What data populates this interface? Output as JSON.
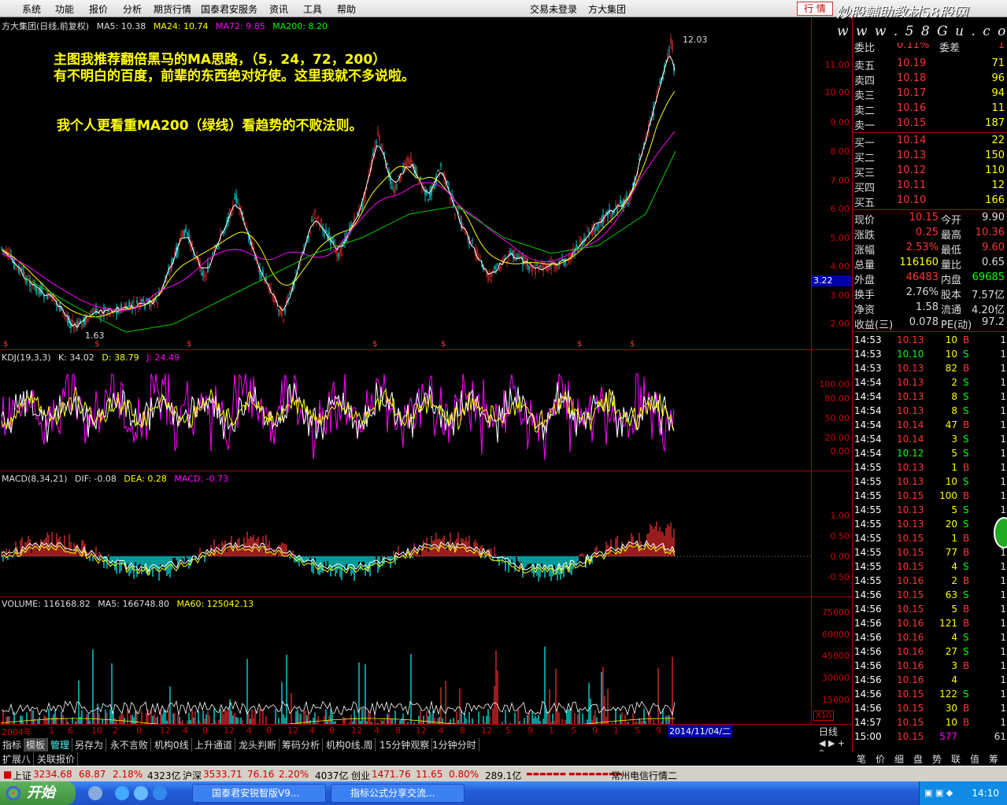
{
  "menu": {
    "items": [
      "系统",
      "功能",
      "报价",
      "分析",
      "期货行情",
      "国泰君安服务",
      "资讯",
      "工具",
      "帮助"
    ],
    "trade_status": "交易未登录",
    "stock_name": "方大集团",
    "quote_button": "行 情"
  },
  "watermark": {
    "title": "炒股輔助教材58股网",
    "url": "w w w . 5 8 G u . c o m"
  },
  "main_chart": {
    "title_name": "方大集团(日线,前复权)",
    "ma5": "MA5: 10.38",
    "ma24": "MA24: 10.74",
    "ma72": "MA72: 9.85",
    "ma200": "MA200: 8.20",
    "high_label": "12.03",
    "low_label": "1.63",
    "last_price_box": "3.22",
    "y_ticks": [
      "11.00",
      "10.00",
      "9.00",
      "8.00",
      "7.00",
      "6.00",
      "5.00",
      "4.00",
      "3.00",
      "2.00"
    ],
    "annotation_line1": "主图我推荐翻倍黑马的MA思路，（5，24，72，200）",
    "annotation_line2": "有不明白的百度，前辈的东西绝对好使。这里我就不多说啦。",
    "annotation_line3": "我个人更看重MA200（绿线）看趋势的不败法则。"
  },
  "kdj": {
    "title": "KDJ(19,3,3)",
    "k": "K: 34.02",
    "d": "D: 38.79",
    "j": "J: 24.49",
    "y_ticks": [
      "100.00",
      "80.00",
      "50.00",
      "20.00",
      "0.00"
    ]
  },
  "macd": {
    "title": "MACD(8,34,21)",
    "dif": "DIF: -0.08",
    "dea": "DEA: 0.28",
    "macd": "MACD: -0.73",
    "y_ticks": [
      "1.00",
      "0.50",
      "0.00",
      "-0.50"
    ]
  },
  "volume": {
    "title": "VOLUME: 116168.82",
    "ma5": "MA5: 166748.80",
    "ma60": "MA60: 125042.13",
    "y_ticks": [
      "75000",
      "60000",
      "45000",
      "30000",
      "15000"
    ],
    "unit": "X10"
  },
  "date_axis": {
    "labels": [
      "2004年",
      "1",
      "6",
      "10",
      "2",
      "8",
      "12",
      "4",
      "8",
      "12",
      "4",
      "8",
      "12",
      "4",
      "8",
      "12",
      "4",
      "8",
      "12",
      "4",
      "8",
      "12",
      "5",
      "9",
      "1",
      "5",
      "9",
      "1",
      "5",
      "9"
    ],
    "current_date": "2014/11/04/二",
    "period": "日线"
  },
  "tabs_row1": [
    "指标",
    "模板",
    "管理",
    "另存为",
    "永不言败",
    "机构0线",
    "上升通道",
    "龙头判断",
    "筹码分析",
    "机构0线.周",
    "15分钟观察",
    "1分钟分时"
  ],
  "tabs_row2": [
    "扩展八",
    "关联报价"
  ],
  "quote": {
    "header": {
      "label": "委比",
      "value": "0.11%",
      "label2": "委差",
      "value2": "1"
    },
    "asks": [
      {
        "label": "卖五",
        "price": "10.19",
        "vol": "71"
      },
      {
        "label": "卖四",
        "price": "10.18",
        "vol": "96"
      },
      {
        "label": "卖三",
        "price": "10.17",
        "vol": "94"
      },
      {
        "label": "卖二",
        "price": "10.16",
        "vol": "11"
      },
      {
        "label": "卖一",
        "price": "10.15",
        "vol": "187"
      }
    ],
    "bids": [
      {
        "label": "买一",
        "price": "10.14",
        "vol": "22"
      },
      {
        "label": "买二",
        "price": "10.13",
        "vol": "150"
      },
      {
        "label": "买三",
        "price": "10.12",
        "vol": "110"
      },
      {
        "label": "买四",
        "price": "10.11",
        "vol": "12"
      },
      {
        "label": "买五",
        "price": "10.10",
        "vol": "166"
      }
    ],
    "stats": [
      {
        "l1": "现价",
        "v1": "10.15",
        "l2": "今开",
        "v2": "9.90"
      },
      {
        "l1": "涨跌",
        "v1": "0.25",
        "l2": "最高",
        "v2": "10.36"
      },
      {
        "l1": "涨幅",
        "v1": "2.53%",
        "l2": "最低",
        "v2": "9.60"
      },
      {
        "l1": "总量",
        "v1": "116160",
        "l2": "量比",
        "v2": "0.65"
      },
      {
        "l1": "外盘",
        "v1": "46483",
        "l2": "内盘",
        "v2": "69685"
      },
      {
        "l1": "换手",
        "v1": "2.76%",
        "l2": "股本",
        "v2": "7.57亿"
      },
      {
        "l1": "净资",
        "v1": "1.58",
        "l2": "流通",
        "v2": "4.20亿"
      },
      {
        "l1": "收益(三)",
        "v1": "0.078",
        "l2": "PE(动)",
        "v2": "97.2"
      }
    ],
    "ticks": [
      {
        "t": "14:53",
        "p": "10.13",
        "v": "10",
        "s": "B",
        "n": "1"
      },
      {
        "t": "14:53",
        "p": "10.10",
        "v": "10",
        "s": "S",
        "n": "1"
      },
      {
        "t": "14:53",
        "p": "10.13",
        "v": "82",
        "s": "B",
        "n": "1"
      },
      {
        "t": "14:54",
        "p": "10.13",
        "v": "2",
        "s": "S",
        "n": "1"
      },
      {
        "t": "14:54",
        "p": "10.13",
        "v": "8",
        "s": "S",
        "n": "1"
      },
      {
        "t": "14:54",
        "p": "10.13",
        "v": "8",
        "s": "S",
        "n": "1"
      },
      {
        "t": "14:54",
        "p": "10.14",
        "v": "47",
        "s": "B",
        "n": "1"
      },
      {
        "t": "14:54",
        "p": "10.14",
        "v": "3",
        "s": "S",
        "n": "1"
      },
      {
        "t": "14:54",
        "p": "10.12",
        "v": "5",
        "s": "S",
        "n": "1"
      },
      {
        "t": "14:55",
        "p": "10.13",
        "v": "1",
        "s": "B",
        "n": "1"
      },
      {
        "t": "14:55",
        "p": "10.13",
        "v": "10",
        "s": "S",
        "n": "1"
      },
      {
        "t": "14:55",
        "p": "10.15",
        "v": "100",
        "s": "B",
        "n": "1"
      },
      {
        "t": "14:55",
        "p": "10.13",
        "v": "5",
        "s": "S",
        "n": "1"
      },
      {
        "t": "14:55",
        "p": "10.13",
        "v": "20",
        "s": "S",
        "n": "1"
      },
      {
        "t": "14:55",
        "p": "10.15",
        "v": "1",
        "s": "B",
        "n": "1"
      },
      {
        "t": "14:55",
        "p": "10.15",
        "v": "77",
        "s": "B",
        "n": "1"
      },
      {
        "t": "14:55",
        "p": "10.15",
        "v": "4",
        "s": "S",
        "n": "1"
      },
      {
        "t": "14:55",
        "p": "10.16",
        "v": "2",
        "s": "B",
        "n": "1"
      },
      {
        "t": "14:56",
        "p": "10.15",
        "v": "63",
        "s": "S",
        "n": "1"
      },
      {
        "t": "14:56",
        "p": "10.15",
        "v": "5",
        "s": "B",
        "n": "1"
      },
      {
        "t": "14:56",
        "p": "10.16",
        "v": "121",
        "s": "B",
        "n": "1"
      },
      {
        "t": "14:56",
        "p": "10.16",
        "v": "4",
        "s": "S",
        "n": "1"
      },
      {
        "t": "14:56",
        "p": "10.16",
        "v": "27",
        "s": "S",
        "n": "1"
      },
      {
        "t": "14:56",
        "p": "10.16",
        "v": "3",
        "s": "B",
        "n": "1"
      },
      {
        "t": "14:56",
        "p": "10.16",
        "v": "4",
        "s": "",
        "n": "1"
      },
      {
        "t": "14:56",
        "p": "10.15",
        "v": "122",
        "s": "S",
        "n": "1"
      },
      {
        "t": "14:56",
        "p": "10.15",
        "v": "30",
        "s": "B",
        "n": "1"
      },
      {
        "t": "14:57",
        "p": "10.15",
        "v": "10",
        "s": "B",
        "n": "1"
      },
      {
        "t": "15:00",
        "p": "10.15",
        "v": "577",
        "s": "",
        "n": "61"
      }
    ],
    "bottom_tabs": [
      "笔",
      "价",
      "细",
      "盘",
      "势",
      "联",
      "值",
      "筹"
    ]
  },
  "statusbar": {
    "sh_label": "上证",
    "sh_value": "3234.68",
    "sh_change": "68.87",
    "sh_pct": "2.18%",
    "sh_amount": "4323亿",
    "hs_label": "沪深",
    "hs_value": "3533.71",
    "hs_change": "76.16",
    "hs_pct": "2.20%",
    "hs_amount": "4037亿",
    "cy_label": "创业",
    "cy_value": "1471.76",
    "cy_change": "11.65",
    "cy_pct": "0.80%",
    "cy_amount": "289.1亿",
    "news": "常州电信行情二"
  },
  "taskbar": {
    "start": "开始",
    "windows": [
      "国泰君安锐智版V9...",
      "指标公式分享交流..."
    ],
    "clock": "14:10"
  },
  "colors": {
    "up": "#ff3333",
    "down": "#00ffff",
    "yellow": "#ffff00",
    "magenta": "#ff00ff",
    "green": "#00cc00",
    "white": "#ffffff"
  }
}
